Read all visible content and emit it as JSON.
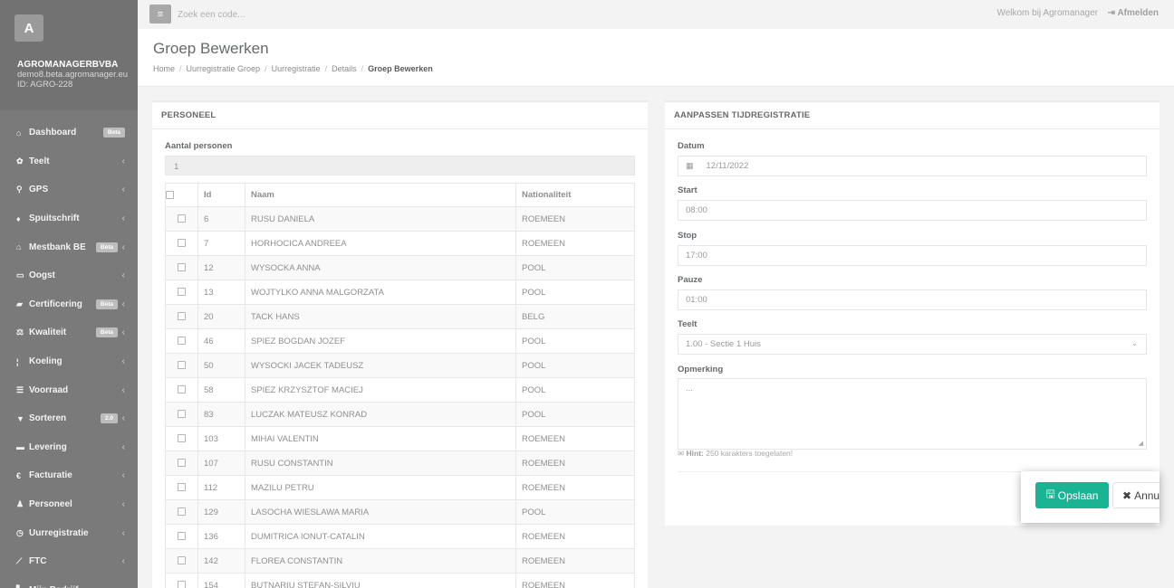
{
  "sidebar": {
    "avatar_letter": "A",
    "company": "AGROMANAGERBVBA",
    "email": "demo8.beta.agromanager.eu",
    "id": "ID: AGRO-228",
    "items": [
      {
        "label": "Dashboard",
        "icon": "home-icon",
        "glyph": "⌂",
        "badge": "Beta",
        "chevron": ""
      },
      {
        "label": "Teelt",
        "icon": "leaf-icon",
        "glyph": "✿",
        "badge": "",
        "chevron": "‹"
      },
      {
        "label": "GPS",
        "icon": "map-marker-icon",
        "glyph": "⚲",
        "badge": "",
        "chevron": "‹"
      },
      {
        "label": "Spuitschrift",
        "icon": "drop-icon",
        "glyph": "♦",
        "badge": "",
        "chevron": "‹"
      },
      {
        "label": "Mestbank BE",
        "icon": "bank-icon",
        "glyph": "⌂",
        "badge": "Bèta",
        "chevron": "‹"
      },
      {
        "label": "Oogst",
        "icon": "basket-icon",
        "glyph": "▭",
        "badge": "",
        "chevron": "‹"
      },
      {
        "label": "Certificering",
        "icon": "book-icon",
        "glyph": "▰",
        "badge": "Bèta",
        "chevron": "‹"
      },
      {
        "label": "Kwaliteit",
        "icon": "balance-scale-icon",
        "glyph": "⚖",
        "badge": "Bèta",
        "chevron": "‹"
      },
      {
        "label": "Koeling",
        "icon": "thermometer-icon",
        "glyph": "¦",
        "badge": "",
        "chevron": "‹"
      },
      {
        "label": "Voorraad",
        "icon": "list-icon",
        "glyph": "☰",
        "badge": "",
        "chevron": "‹"
      },
      {
        "label": "Sorteren",
        "icon": "filter-icon",
        "glyph": "▼",
        "badge": "2.0",
        "chevron": "‹"
      },
      {
        "label": "Levering",
        "icon": "truck-icon",
        "glyph": "▬",
        "badge": "",
        "chevron": "‹"
      },
      {
        "label": "Facturatie",
        "icon": "euro-icon",
        "glyph": "€",
        "badge": "",
        "chevron": "‹"
      },
      {
        "label": "Personeel",
        "icon": "user-icon",
        "glyph": "♟",
        "badge": "",
        "chevron": "‹"
      },
      {
        "label": "Uurregistratie",
        "icon": "clock-icon",
        "glyph": "◷",
        "badge": "",
        "chevron": "‹"
      },
      {
        "label": "FTC",
        "icon": "line-chart-icon",
        "glyph": "⟋",
        "badge": "",
        "chevron": "‹"
      },
      {
        "label": "Mijn Bedrijf",
        "icon": "building-icon",
        "glyph": "▙",
        "badge": "",
        "chevron": "‹"
      }
    ]
  },
  "topbar": {
    "menu_glyph": "≡",
    "search_placeholder": "Zoek een code...",
    "welcome": "Welkom bij Agromanager",
    "logout_glyph": "⇥",
    "logout": "Afmelden"
  },
  "header": {
    "title": "Groep Bewerken",
    "breadcrumb": [
      "Home",
      "Uurregistratie Groep",
      "Uurregistratie",
      "Details"
    ],
    "breadcrumb_active": "Groep Bewerken",
    "separator": "/"
  },
  "personeel": {
    "title": "PERSONEEL",
    "count_label": "Aantal personen",
    "count_value": "1",
    "columns": {
      "id": "Id",
      "naam": "Naam",
      "nationaliteit": "Nationaliteit"
    },
    "rows": [
      {
        "id": "6",
        "naam": "RUSU DANIELA",
        "nat": "ROEMEEN"
      },
      {
        "id": "7",
        "naam": "HORHOCICA ANDREEA",
        "nat": "ROEMEEN"
      },
      {
        "id": "12",
        "naam": "WYSOCKA ANNA",
        "nat": "POOL"
      },
      {
        "id": "13",
        "naam": "WOJTYLKO ANNA MALGORZATA",
        "nat": "POOL"
      },
      {
        "id": "20",
        "naam": "TACK HANS",
        "nat": "BELG"
      },
      {
        "id": "46",
        "naam": "SPIEZ BOGDAN JOZEF",
        "nat": "POOL"
      },
      {
        "id": "50",
        "naam": "WYSOCKI JACEK TADEUSZ",
        "nat": "POOL"
      },
      {
        "id": "58",
        "naam": "SPIEZ KRZYSZTOF MACIEJ",
        "nat": "POOL"
      },
      {
        "id": "83",
        "naam": "LUCZAK MATEUSZ KONRAD",
        "nat": "POOL"
      },
      {
        "id": "103",
        "naam": "MIHAI VALENTIN",
        "nat": "ROEMEEN"
      },
      {
        "id": "107",
        "naam": "RUSU CONSTANTIN",
        "nat": "ROEMEEN"
      },
      {
        "id": "112",
        "naam": "MAZILU PETRU",
        "nat": "ROEMEEN"
      },
      {
        "id": "129",
        "naam": "LASOCHA WIESLAWA MARIA",
        "nat": "POOL"
      },
      {
        "id": "136",
        "naam": "DUMITRICA IONUT-CATALIN",
        "nat": "ROEMEEN"
      },
      {
        "id": "142",
        "naam": "FLOREA CONSTANTIN",
        "nat": "ROEMEEN"
      },
      {
        "id": "154",
        "naam": "BUTNARIU STEFAN-SILVIU",
        "nat": "ROEMEEN"
      }
    ]
  },
  "tijd": {
    "title": "AANPASSEN TIJDREGISTRATIE",
    "datum_label": "Datum",
    "datum_value": "12/11/2022",
    "calendar_glyph": "▦",
    "start_label": "Start",
    "start_value": "08:00",
    "stop_label": "Stop",
    "stop_value": "17:00",
    "pauze_label": "Pauze",
    "pauze_value": "01:00",
    "teelt_label": "Teelt",
    "teelt_value": "1.00 - Sectie 1 Huis",
    "select_glyph": "⌄",
    "opmerking_label": "Opmerking",
    "opmerking_placeholder": "...",
    "hint_glyph": "✉",
    "hint_bold": "Hint:",
    "hint_text": " 250 karakters toegelaten!"
  },
  "actions": {
    "save_glyph": "🖫",
    "save": "Opslaan",
    "cancel_glyph": "✖",
    "cancel": "Annuleren"
  },
  "colors": {
    "sidebar": "#7a7a7a",
    "accent": "#1ab394"
  }
}
